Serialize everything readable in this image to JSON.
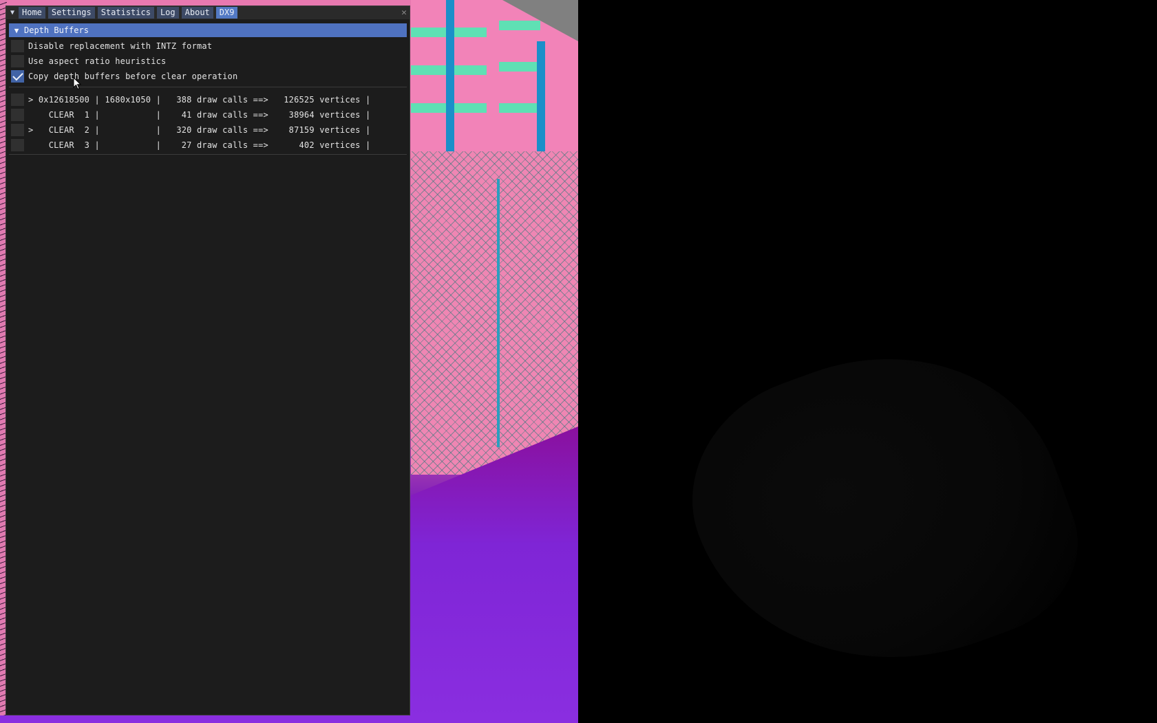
{
  "window": {
    "tabs": [
      {
        "label": "Home"
      },
      {
        "label": "Settings"
      },
      {
        "label": "Statistics"
      },
      {
        "label": "Log"
      },
      {
        "label": "About"
      },
      {
        "label": "DX9"
      }
    ],
    "active_tab": "DX9",
    "close_symbol": "✕"
  },
  "section": {
    "title": "Depth Buffers",
    "expanded": true
  },
  "options": [
    {
      "label": "Disable replacement with INTZ format",
      "checked": false
    },
    {
      "label": "Use aspect ratio heuristics",
      "checked": false
    },
    {
      "label": "Copy depth buffers before clear operation",
      "checked": true
    }
  ],
  "buffers": [
    {
      "text": "> 0x12618500 | 1680x1050 |   388 draw calls ==>   126525 vertices |"
    },
    {
      "text": "    CLEAR  1 |           |    41 draw calls ==>    38964 vertices |"
    },
    {
      "text": ">   CLEAR  2 |           |   320 draw calls ==>    87159 vertices |"
    },
    {
      "text": "    CLEAR  3 |           |    27 draw calls ==>      402 vertices |"
    }
  ],
  "colors": {
    "accent": "#4f72c0",
    "active_tab": "#5279c4",
    "tab": "#3d4a66",
    "window_bg": "#1c1c1c"
  }
}
